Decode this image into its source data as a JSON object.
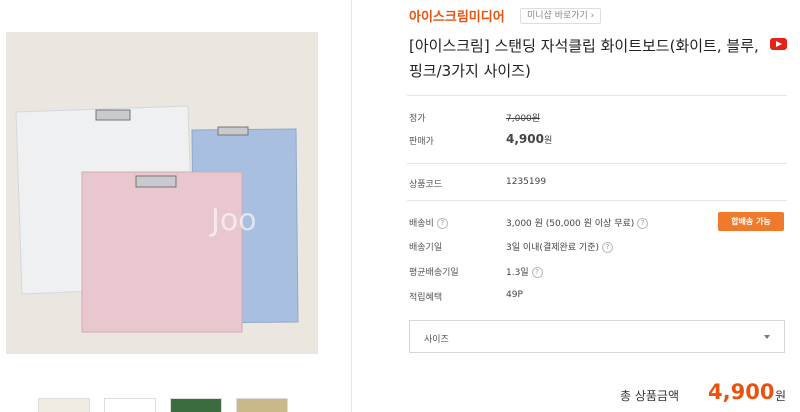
{
  "store": {
    "name": "아이스크림미디어",
    "mini_shop_label": "미니샵 바로가기 ›"
  },
  "product": {
    "title": "[아이스크림] 스탠딩 자석클립 화이트보드(화이트, 블루, 핑크/3가지 사이즈)"
  },
  "price": {
    "list_label": "정가",
    "list_value": "7,000원",
    "sale_label": "판매가",
    "sale_value": "4,900",
    "sale_unit": "원"
  },
  "details": [
    {
      "label": "상품코드",
      "value": "1235199"
    },
    {
      "label": "배송비",
      "value": "3,000 원 (50,000 원 이상 무료)"
    },
    {
      "label": "배송기일",
      "value": "3일 이내(결제완료 기준)"
    },
    {
      "label": "평균배송기일",
      "value": "1.3일"
    },
    {
      "label": "적립혜택",
      "value": "49P"
    }
  ],
  "shipping_button": "합배송 가능",
  "option_select": {
    "selected": "사이즈"
  },
  "total": {
    "label": "총 상품금액",
    "amount": "4,900",
    "unit": "원"
  },
  "brand_colors": {
    "accent": "#e8530f",
    "button": "#f07a2c"
  },
  "icons": [
    "youtube-icon",
    "help-icon",
    "chevron-down-icon"
  ]
}
